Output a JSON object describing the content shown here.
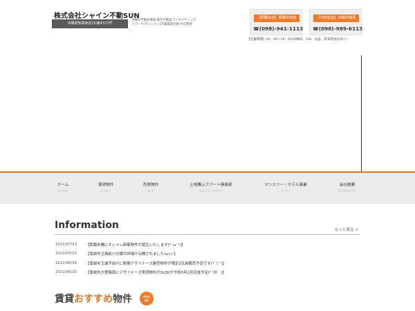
{
  "header": {
    "company_name": "株式会社シャイン不動SUN",
    "license": "沖縄県知事免許(3)第4373号",
    "description": [
      "沖縄の不動産情報 総合不動産コンサルティング",
      "アパート/マンション/店舗賃貸売買/外の管理"
    ]
  },
  "contacts": [
    {
      "tag": "【那覇本店】那覇市安謝",
      "phone": "(098)-941-1113",
      "icon": "phone-icon"
    },
    {
      "tag": "【中部支店】沖縄市美原",
      "phone": "(098)-989-6113",
      "icon": "phone-icon"
    }
  ],
  "hours": "【営業時間】09：00～18：00(日曜日、GW、お盆、年末年始を除く)",
  "nav": [
    {
      "jp": "ホーム",
      "en": "HOME"
    },
    {
      "jp": "賃貸物件",
      "en": "RENT"
    },
    {
      "jp": "売買物件",
      "en": "BUY"
    },
    {
      "jp": "土地購入アパート倶楽部",
      "en": "INVESTMENT"
    },
    {
      "jp": "マンスリー・ホテル事業",
      "en": "STAY"
    },
    {
      "jp": "会社概要",
      "en": "COMPANY"
    }
  ],
  "info": {
    "title": "Information",
    "more": "もっと見る >",
    "news": [
      {
        "date": "2022/07/23",
        "title": "【那覇市曙にオシャレ新築物件が誕生いたします(*´ω`*)】"
      },
      {
        "date": "2022/07/23",
        "title": "【南城市玉城前川分譲の詳細が公開されました(ω)ノ】"
      },
      {
        "date": "2022/06/30",
        "title": "【南城市玉城字前川に新築デザイナーズ建売物件が限定2区画販売予定です(*´▽`)】"
      },
      {
        "date": "2022/06/30",
        "title": "【南城市大里稲嶺にデザイナーズ賃貸物件が3LDKが令和5年2月完成予定(*´艸｀)】"
      }
    ]
  },
  "recommend": {
    "prefix": "賃貸",
    "accent": "おすすめ",
    "suffix": "物件",
    "badge_line1": "Pick",
    "badge_line2": "Up"
  },
  "colors": {
    "accent": "#e8731f",
    "phone_tag": "#ef7a2a",
    "nav_bg": "#ececec",
    "license_bar": "#5a5a5a"
  }
}
